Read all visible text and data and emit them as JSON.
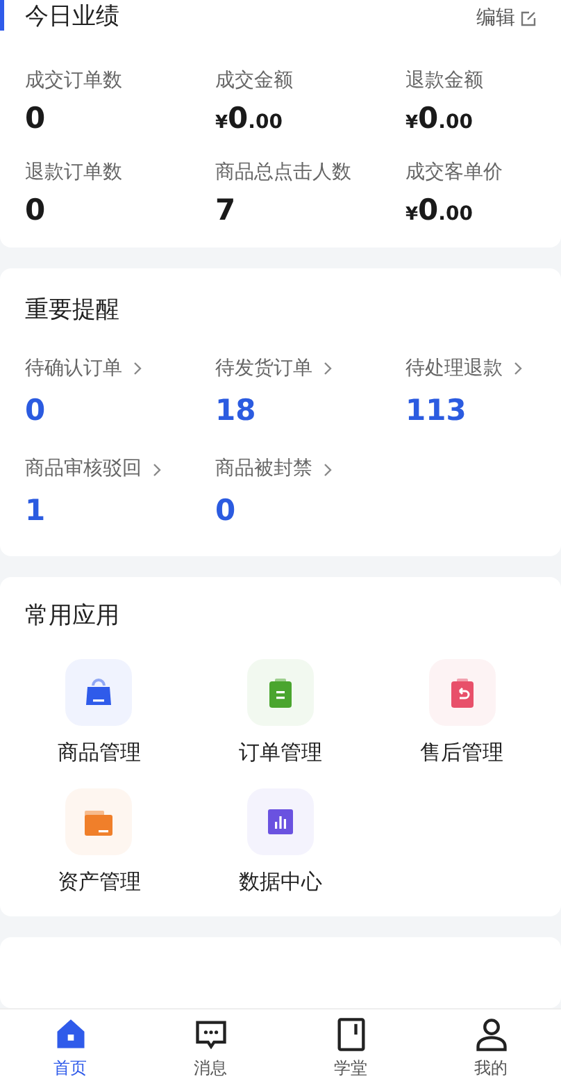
{
  "performance": {
    "title": "今日业绩",
    "edit_link": "编辑",
    "metrics": [
      {
        "label": "成交订单数",
        "value": "0"
      },
      {
        "label": "成交金额",
        "currency": "¥",
        "value": "0",
        "fraction": ".00"
      },
      {
        "label": "退款金额",
        "currency": "¥",
        "value": "0",
        "fraction": ".00"
      },
      {
        "label": "退款订单数",
        "value": "0"
      },
      {
        "label": "商品总点击人数",
        "value": "7"
      },
      {
        "label": "成交客单价",
        "currency": "¥",
        "value": "0",
        "fraction": ".00"
      }
    ]
  },
  "reminders": {
    "title": "重要提醒",
    "items": [
      {
        "label": "待确认订单",
        "value": "0"
      },
      {
        "label": "待发货订单",
        "value": "18"
      },
      {
        "label": "待处理退款",
        "value": "113"
      },
      {
        "label": "商品审核驳回",
        "value": "1"
      },
      {
        "label": "商品被封禁",
        "value": "0"
      }
    ]
  },
  "apps": {
    "title": "常用应用",
    "items": [
      {
        "label": "商品管理",
        "kind": "bag",
        "color": "#2f5bea"
      },
      {
        "label": "订单管理",
        "kind": "clipboard",
        "color": "#4aa52e"
      },
      {
        "label": "售后管理",
        "kind": "return",
        "color": "#e8506a"
      },
      {
        "label": "资产管理",
        "kind": "folder",
        "color": "#f07f2a"
      },
      {
        "label": "数据中心",
        "kind": "chart",
        "color": "#6a52e0"
      }
    ]
  },
  "tab_bar": [
    {
      "label": "首页",
      "kind": "home",
      "selected": true
    },
    {
      "label": "消息",
      "kind": "message",
      "selected": false
    },
    {
      "label": "学堂",
      "kind": "book",
      "selected": false
    },
    {
      "label": "我的",
      "kind": "profile",
      "selected": false
    }
  ]
}
